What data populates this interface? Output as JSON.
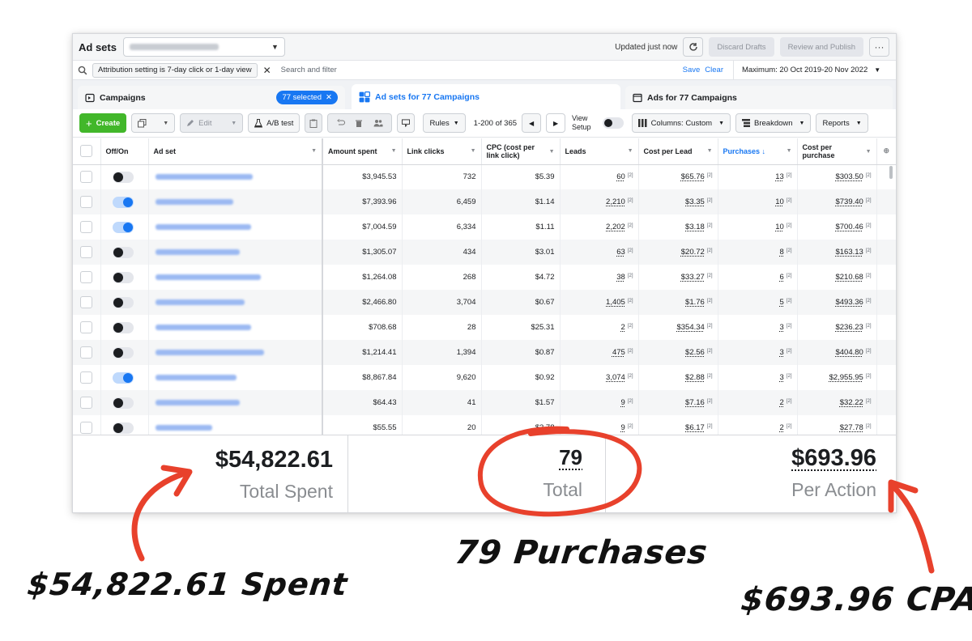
{
  "topbar": {
    "title": "Ad sets",
    "updated": "Updated just now",
    "discard": "Discard Drafts",
    "review": "Review and Publish",
    "more": "···"
  },
  "filter": {
    "chip": "Attribution setting is 7-day click or 1-day view",
    "search_placeholder": "Search and filter",
    "save": "Save",
    "clear": "Clear",
    "date_range": "Maximum: 20 Oct 2019-20 Nov 2022"
  },
  "tabs": {
    "campaigns": "Campaigns",
    "selected": "77 selected",
    "adsets": "Ad sets for 77 Campaigns",
    "ads": "Ads for 77 Campaigns"
  },
  "toolbar": {
    "create": "Create",
    "edit": "Edit",
    "ab_test": "A/B test",
    "rules": "Rules",
    "pager": "1-200 of 365",
    "view_setup_1": "View",
    "view_setup_2": "Setup",
    "columns": "Columns: Custom",
    "breakdown": "Breakdown",
    "reports": "Reports"
  },
  "columns": {
    "offon": "Off/On",
    "adset": "Ad set",
    "amount": "Amount spent",
    "clicks": "Link clicks",
    "cpc_1": "CPC (cost per",
    "cpc_2": "link click)",
    "leads": "Leads",
    "cpl": "Cost per Lead",
    "purchases": "Purchases ↓",
    "cpp_1": "Cost per",
    "cpp_2": "purchase"
  },
  "footnote": "[2]",
  "rows": [
    {
      "on": false,
      "spent": "$3,945.53",
      "clicks": "732",
      "cpc": "$5.39",
      "leads": "60",
      "cpl": "$65.76",
      "purchases": "13",
      "cpp": "$303.50"
    },
    {
      "on": true,
      "spent": "$7,393.96",
      "clicks": "6,459",
      "cpc": "$1.14",
      "leads": "2,210",
      "cpl": "$3.35",
      "purchases": "10",
      "cpp": "$739.40"
    },
    {
      "on": true,
      "spent": "$7,004.59",
      "clicks": "6,334",
      "cpc": "$1.11",
      "leads": "2,202",
      "cpl": "$3.18",
      "purchases": "10",
      "cpp": "$700.46"
    },
    {
      "on": false,
      "spent": "$1,305.07",
      "clicks": "434",
      "cpc": "$3.01",
      "leads": "63",
      "cpl": "$20.72",
      "purchases": "8",
      "cpp": "$163.13"
    },
    {
      "on": false,
      "spent": "$1,264.08",
      "clicks": "268",
      "cpc": "$4.72",
      "leads": "38",
      "cpl": "$33.27",
      "purchases": "6",
      "cpp": "$210.68"
    },
    {
      "on": false,
      "spent": "$2,466.80",
      "clicks": "3,704",
      "cpc": "$0.67",
      "leads": "1,405",
      "cpl": "$1.76",
      "purchases": "5",
      "cpp": "$493.36"
    },
    {
      "on": false,
      "spent": "$708.68",
      "clicks": "28",
      "cpc": "$25.31",
      "leads": "2",
      "cpl": "$354.34",
      "purchases": "3",
      "cpp": "$236.23"
    },
    {
      "on": false,
      "spent": "$1,214.41",
      "clicks": "1,394",
      "cpc": "$0.87",
      "leads": "475",
      "cpl": "$2.56",
      "purchases": "3",
      "cpp": "$404.80"
    },
    {
      "on": true,
      "spent": "$8,867.84",
      "clicks": "9,620",
      "cpc": "$0.92",
      "leads": "3,074",
      "cpl": "$2.88",
      "purchases": "3",
      "cpp": "$2,955.95"
    },
    {
      "on": false,
      "spent": "$64.43",
      "clicks": "41",
      "cpc": "$1.57",
      "leads": "9",
      "cpl": "$7.16",
      "purchases": "2",
      "cpp": "$32.22"
    },
    {
      "on": false,
      "spent": "$55.55",
      "clicks": "20",
      "cpc": "$2.78",
      "leads": "9",
      "cpl": "$6.17",
      "purchases": "2",
      "cpp": "$27.78"
    }
  ],
  "summary": {
    "spent_value": "$54,822.61",
    "spent_label": "Total Spent",
    "purchases_value": "79",
    "purchases_label": "Total",
    "cpa_value": "$693.96",
    "cpa_label": "Per Action"
  },
  "annotations": {
    "spent": "$54,822.61 Spent",
    "purchases": "79 Purchases",
    "cpa": "$693.96 CPA"
  },
  "colors": {
    "accent": "#1877f2",
    "green": "#42b72a",
    "annotation_red": "#e8412c"
  },
  "icons": [
    "search-icon",
    "refresh-icon",
    "close-icon",
    "grid-icon",
    "duplicate-icon",
    "pencil-icon",
    "flask-icon",
    "undo-icon",
    "trash-icon",
    "people-icon",
    "caret-down-icon",
    "chevron-left-icon",
    "chevron-right-icon",
    "columns-icon",
    "breakdown-icon"
  ]
}
